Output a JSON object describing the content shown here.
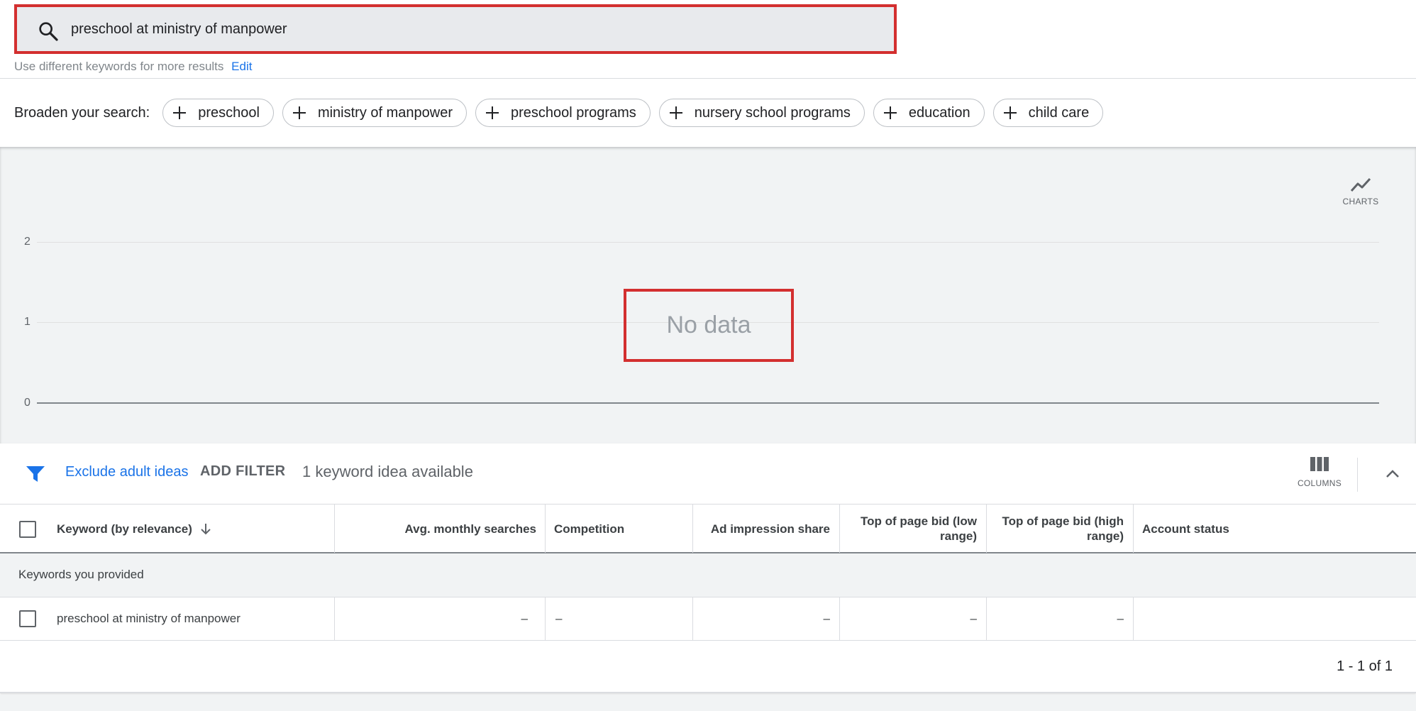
{
  "search": {
    "value": "preschool at ministry of manpower",
    "hint": "Use different keywords for more results",
    "edit_label": "Edit"
  },
  "broaden": {
    "label": "Broaden your search:",
    "chips": [
      {
        "label": "preschool"
      },
      {
        "label": "ministry of manpower"
      },
      {
        "label": "preschool programs"
      },
      {
        "label": "nursery school programs"
      },
      {
        "label": "education"
      },
      {
        "label": "child care"
      }
    ]
  },
  "chart": {
    "button_label": "CHARTS",
    "no_data": "No data",
    "y_ticks": [
      "2",
      "1",
      "0"
    ]
  },
  "chart_data": {
    "type": "line",
    "title": "",
    "series": [],
    "ylim": [
      0,
      2
    ],
    "yticks": [
      0,
      1,
      2
    ],
    "grid": true,
    "annotation": "No data"
  },
  "filters": {
    "exclude_adult": "Exclude adult ideas",
    "add_filter": "ADD FILTER",
    "count_text": "1 keyword idea available",
    "columns_label": "COLUMNS"
  },
  "table": {
    "headers": {
      "keyword": "Keyword (by relevance)",
      "avg_searches": "Avg. monthly searches",
      "competition": "Competition",
      "ad_share": "Ad impression share",
      "bid_low": "Top of page bid (low range)",
      "bid_high": "Top of page bid (high range)",
      "account_status": "Account status"
    },
    "group_label": "Keywords you provided",
    "rows": [
      {
        "keyword": "preschool at ministry of manpower",
        "avg_searches": "–",
        "competition": "–",
        "ad_share": "–",
        "bid_low": "–",
        "bid_high": "–",
        "account_status": ""
      }
    ],
    "pagination": "1 - 1 of 1"
  },
  "colors": {
    "accent": "#1a73e8",
    "highlight_border": "#d32f2f",
    "chart_bg": "#f1f3f4"
  }
}
